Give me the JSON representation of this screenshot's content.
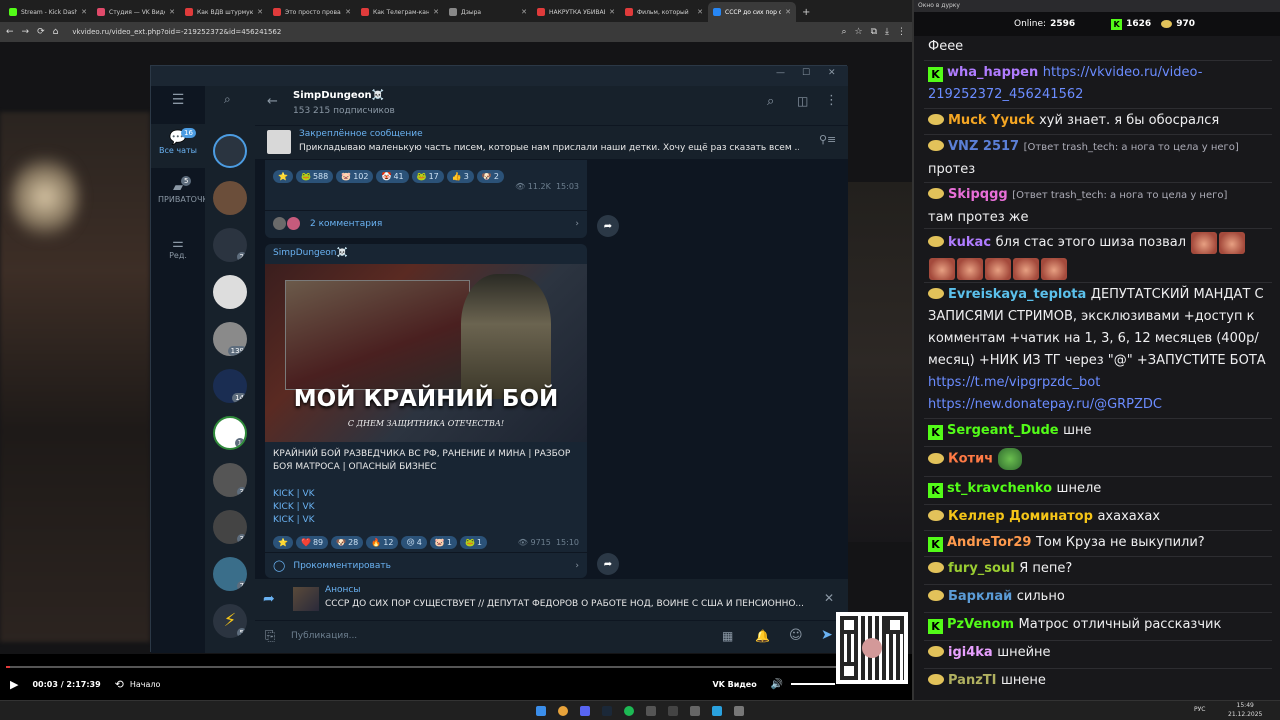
{
  "browser": {
    "tabs": [
      {
        "label": "Stream - Kick Dash",
        "color": "#53fc18"
      },
      {
        "label": "Студия — VK Видео",
        "color": "#e04a6a"
      },
      {
        "label": "Как ВДВ штурмуют",
        "color": "#e03b3b"
      },
      {
        "label": "Это просто провал",
        "color": "#e03b3b"
      },
      {
        "label": "Как Телеграм-канал",
        "color": "#e03b3b"
      },
      {
        "label": "Дзыра",
        "color": "#888"
      },
      {
        "label": "НАКРУТКА УБИВАЕ",
        "color": "#e03b3b"
      },
      {
        "label": "Фильм, который",
        "color": "#e03b3b"
      },
      {
        "label": "СССР до сих пор с",
        "color": "#2787f5"
      }
    ],
    "url": "vkvideo.ru/video_ext.php?oid=-219252372&id=456241562"
  },
  "telegram": {
    "folders": [
      {
        "label": "Все чаты",
        "badge": "16"
      },
      {
        "label": "ПРИВАТОЧКА",
        "badge": "5"
      },
      {
        "label": "Ред.",
        "badge": ""
      }
    ],
    "chat_badges": [
      "2",
      "139",
      "14",
      "1",
      "3",
      "3",
      "7",
      "5"
    ],
    "channel": {
      "name": "SimpDungeon☠️",
      "subscribers": "153 215 подписчиков"
    },
    "pinned": {
      "title": "Закреплённое сообщение",
      "text": "Прикладываю маленькую часть писем, которые нам прислали наши детки.   Хочу ещё раз сказать всем ..."
    },
    "post1": {
      "reactions": [
        {
          "e": "⭐",
          "n": ""
        },
        {
          "e": "🐸",
          "n": "588"
        },
        {
          "e": "🐷",
          "n": "102"
        },
        {
          "e": "🤡",
          "n": "41"
        },
        {
          "e": "🐸",
          "n": "17"
        },
        {
          "e": "👍",
          "n": "3"
        },
        {
          "e": "🐶",
          "n": "2"
        }
      ],
      "views": "11.2K",
      "time": "15:03",
      "comments": "2 комментария"
    },
    "post2": {
      "author": "SimpDungeon☠️",
      "image_title": "МОЙ КРАЙНИЙ БОЙ",
      "image_subtitle": "С ДНЕМ ЗАЩИТНИКА ОТЕЧЕСТВА!",
      "text": "КРАЙНИЙ БОЙ РАЗВЕДЧИКА ВС РФ, РАНЕНИЕ И МИНА | РАЗБОР БОЯ МАТРОСА | ОПАСНЫЙ БИЗНЕС",
      "links": [
        "KICK | VK",
        "KICK | VK",
        "KICK | VK"
      ],
      "reactions": [
        {
          "e": "⭐",
          "n": ""
        },
        {
          "e": "❤️",
          "n": "89"
        },
        {
          "e": "🐶",
          "n": "28"
        },
        {
          "e": "🔥",
          "n": "12"
        },
        {
          "e": "😢",
          "n": "4"
        },
        {
          "e": "🐷",
          "n": "1"
        },
        {
          "e": "🐸",
          "n": "1"
        }
      ],
      "views": "9715",
      "time": "15:10",
      "comment_label": "Прокомментировать"
    },
    "forward": {
      "title": "Анонсы",
      "text": "СССР ДО СИХ ПОР СУЩЕСТВУЕТ // ДЕПУТАТ ФЁДОРОВ О РАБОТЕ НОД, ВОЙНЕ С США И ПЕНСИОННО..."
    },
    "input_placeholder": "Публикация..."
  },
  "player": {
    "time": "00:03 / 2:17:39",
    "start_label": "Начало",
    "brand": "VK Видео",
    "progress": 0.0004
  },
  "taskbar": {
    "lang": "РУС",
    "clock_time": "15:49",
    "clock_date": "21.12.2025"
  },
  "chat": {
    "window_title": "Окно в дурку",
    "online_label": "Online:",
    "online": "2596",
    "kick_count": "1626",
    "vk_count": "970",
    "lines": [
      {
        "badge": "",
        "nick": "",
        "color": "#fff",
        "reply": "",
        "text": "Феее"
      },
      {
        "badge": "kick",
        "nick": "wha_happen",
        "color": "#b07cff",
        "reply": "",
        "text": "",
        "link": "https://vkvideo.ru/video-219252372_456241562"
      },
      {
        "badge": "vk",
        "nick": "Muck Yyuck",
        "color": "#f5a623",
        "reply": "",
        "text": "хуй знает. я бы обосрался"
      },
      {
        "badge": "vk",
        "nick": "VNZ 2517",
        "color": "#5b7fd6",
        "reply": "[Ответ trash_tech: а нога то цела у него]",
        "text": "протез"
      },
      {
        "badge": "vk",
        "nick": "Skipqgg",
        "color": "#e86fd8",
        "reply": "[Ответ trash_tech: а нога то цела у него]",
        "text": "там протез же"
      },
      {
        "badge": "vk",
        "nick": "kukac",
        "color": "#b07cff",
        "reply": "",
        "text": "бля стас этого шиза позвал"
      },
      {
        "badge": "vk",
        "nick": "Evreiskaya_teplota",
        "color": "#5bc0eb",
        "reply": "",
        "text": "ДЕПУТАТСКИЙ МАНДАТ С ЗАПИСЯМИ СТРИМОВ, эксклюзивами +доступ к комментам +чатик на 1, 3, 6, 12 месяцев (400р/месяц) +НИК ИЗ ТГ через \"@\" +ЗАПУСТИТЕ БОТА",
        "link": "https://t.me/vipgrpzdc_bot",
        "link2": "https://new.donatepay.ru/@GRPZDC"
      },
      {
        "badge": "kick",
        "nick": "Sergeant_Dude",
        "color": "#53fc18",
        "reply": "",
        "text": "шне"
      },
      {
        "badge": "vk",
        "nick": "Котич",
        "color": "#ff7a45",
        "reply": "",
        "text": ""
      },
      {
        "badge": "kick",
        "nick": "st_kravchenko",
        "color": "#53fc18",
        "reply": "",
        "text": "шнеле"
      },
      {
        "badge": "vk",
        "nick": "Келлер Доминатор",
        "color": "#f5c518",
        "reply": "",
        "text": "ахахахах"
      },
      {
        "badge": "kick",
        "nick": "AndreTor29",
        "color": "#ff9a4d",
        "reply": "",
        "text": "Том Круза не выкупили?"
      },
      {
        "badge": "vk",
        "nick": "fury_soul",
        "color": "#9acd32",
        "reply": "",
        "text": "Я пепе?"
      },
      {
        "badge": "vk",
        "nick": "Барклай",
        "color": "#5b9bd6",
        "reply": "",
        "text": "сильно"
      },
      {
        "badge": "kick",
        "nick": "PzVenom",
        "color": "#53fc18",
        "reply": "",
        "text": "Матрос отличный рассказчик"
      },
      {
        "badge": "vk",
        "nick": "igi4ka",
        "color": "#e8a0ff",
        "reply": "",
        "text": "шнейне"
      },
      {
        "badge": "vk",
        "nick": "PanzTI",
        "color": "#b0b060",
        "reply": "",
        "text": "шнене"
      }
    ]
  }
}
